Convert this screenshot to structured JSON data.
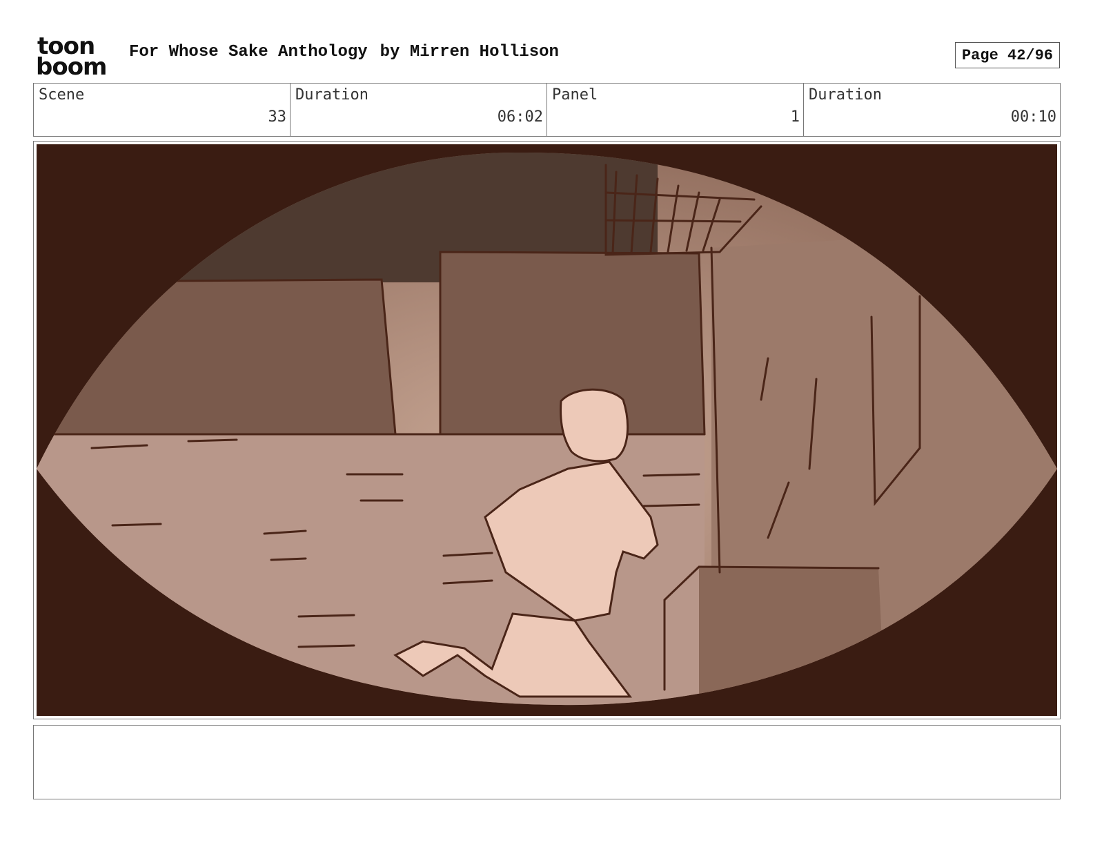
{
  "header": {
    "logo_text_top": "toon",
    "logo_text_bottom": "boom",
    "project_title": "For Whose Sake Anthology",
    "author": "by Mirren Hollison",
    "page_indicator": "Page 42/96"
  },
  "info": {
    "scene_label": "Scene",
    "scene_value": "33",
    "scene_duration_label": "Duration",
    "scene_duration_value": "06:02",
    "panel_label": "Panel",
    "panel_value": "1",
    "panel_duration_label": "Duration",
    "panel_duration_value": "00:10"
  },
  "colors": {
    "vignette": "#3a1c12",
    "wall": "#b8978a",
    "building": "#7a5a4c",
    "sky": "#4e3a30",
    "lines": "#4a2518",
    "figure": "#edc9b8"
  },
  "notes": {
    "text": ""
  }
}
